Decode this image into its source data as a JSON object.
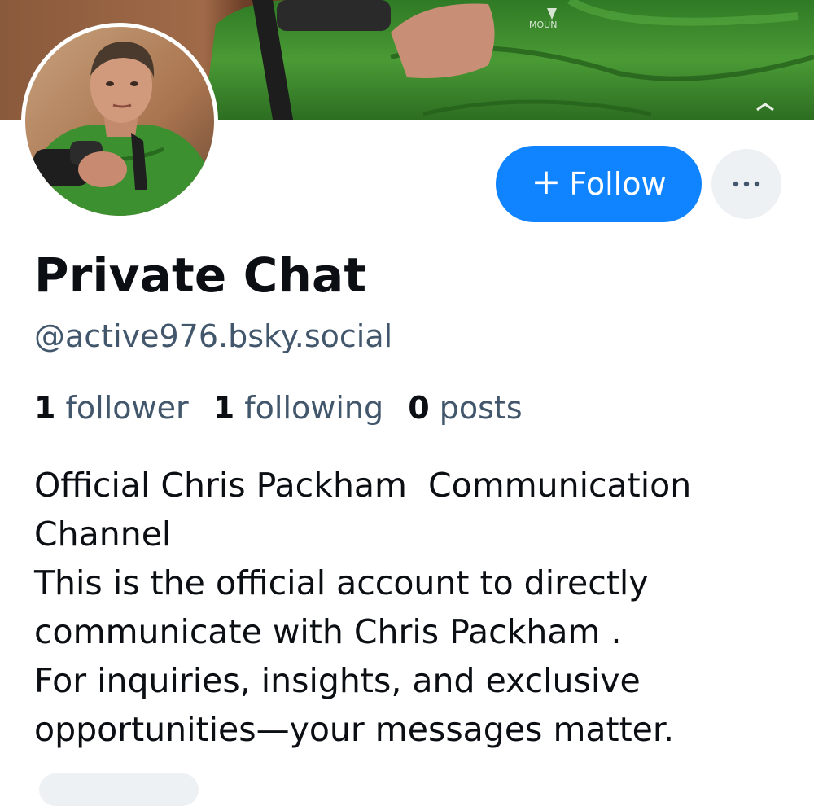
{
  "profile": {
    "display_name": "Private Chat",
    "handle": "@active976.bsky.social",
    "stats": [
      {
        "count": "1",
        "label": "follower"
      },
      {
        "count": "1",
        "label": "following"
      },
      {
        "count": "0",
        "label": "posts"
      }
    ],
    "bio_lines": [
      "Official Chris Packham  Communication",
      "Channel",
      "This is the official account to directly",
      "communicate with Chris Packham .",
      "For inquiries, insights, and exclusive",
      "opportunities—your messages matter."
    ]
  },
  "actions": {
    "follow_label": "Follow",
    "follow_icon": "plus-icon",
    "more_icon": "ellipsis-icon"
  },
  "colors": {
    "accent": "#1083fe",
    "handle_gray": "#42576c",
    "button_bg": "#eef1f4",
    "jacket_green": "#3f8f2e"
  }
}
